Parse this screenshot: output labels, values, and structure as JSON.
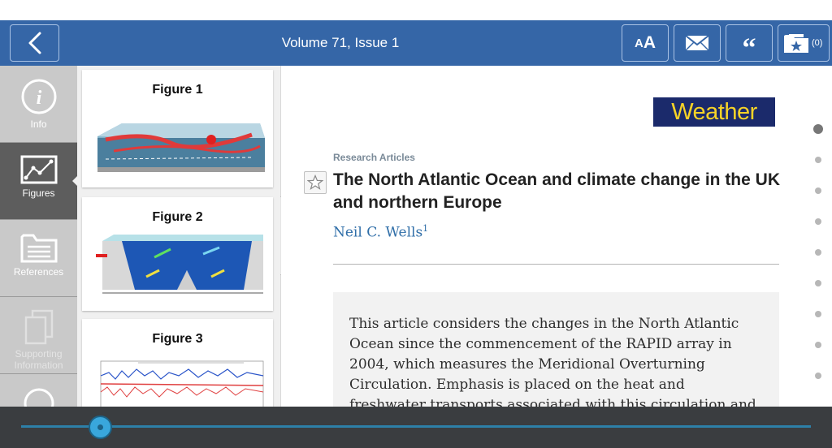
{
  "header": {
    "issue_title": "Volume 71, Issue 1",
    "font_button_label_small": "A",
    "font_button_label_big": "A",
    "quote_label": "“",
    "favorites_count": "(0)"
  },
  "side_nav": {
    "items": [
      {
        "label": "Info",
        "icon": "info-icon"
      },
      {
        "label": "Figures",
        "icon": "figures-chart-icon"
      },
      {
        "label": "References",
        "icon": "references-folder-icon"
      },
      {
        "label": "Supporting Information",
        "icon": "supporting-info-icon"
      },
      {
        "label": "",
        "icon": "circle-icon"
      }
    ],
    "active": "Figures"
  },
  "figures": [
    {
      "title": "Figure 1"
    },
    {
      "title": "Figure 2"
    },
    {
      "title": "Figure 3"
    }
  ],
  "article": {
    "journal": "Weather",
    "section": "Research Articles",
    "title": "The North Atlantic Ocean and climate change in the UK and northern Europe",
    "author": "Neil C. Wells",
    "author_affiliation_mark": "1",
    "abstract": "This article considers the changes in the North Atlantic Ocean since the commencement of the RAPID array in 2004, which measures the Meridional Overturning Circulation. Emphasis is placed on the heat and freshwater transports associated with this circulation and its influence"
  },
  "pager": {
    "total": 9,
    "current": 1
  },
  "slider": {
    "position_fraction": 0.1
  },
  "colors": {
    "header_bg": "#3566a7",
    "nav_active_bg": "#5d5d5d",
    "logo_bg": "#1b2a6b",
    "logo_text": "#f7d327",
    "link_blue": "#2f6ea8",
    "slider_accent": "#39a7dc"
  }
}
